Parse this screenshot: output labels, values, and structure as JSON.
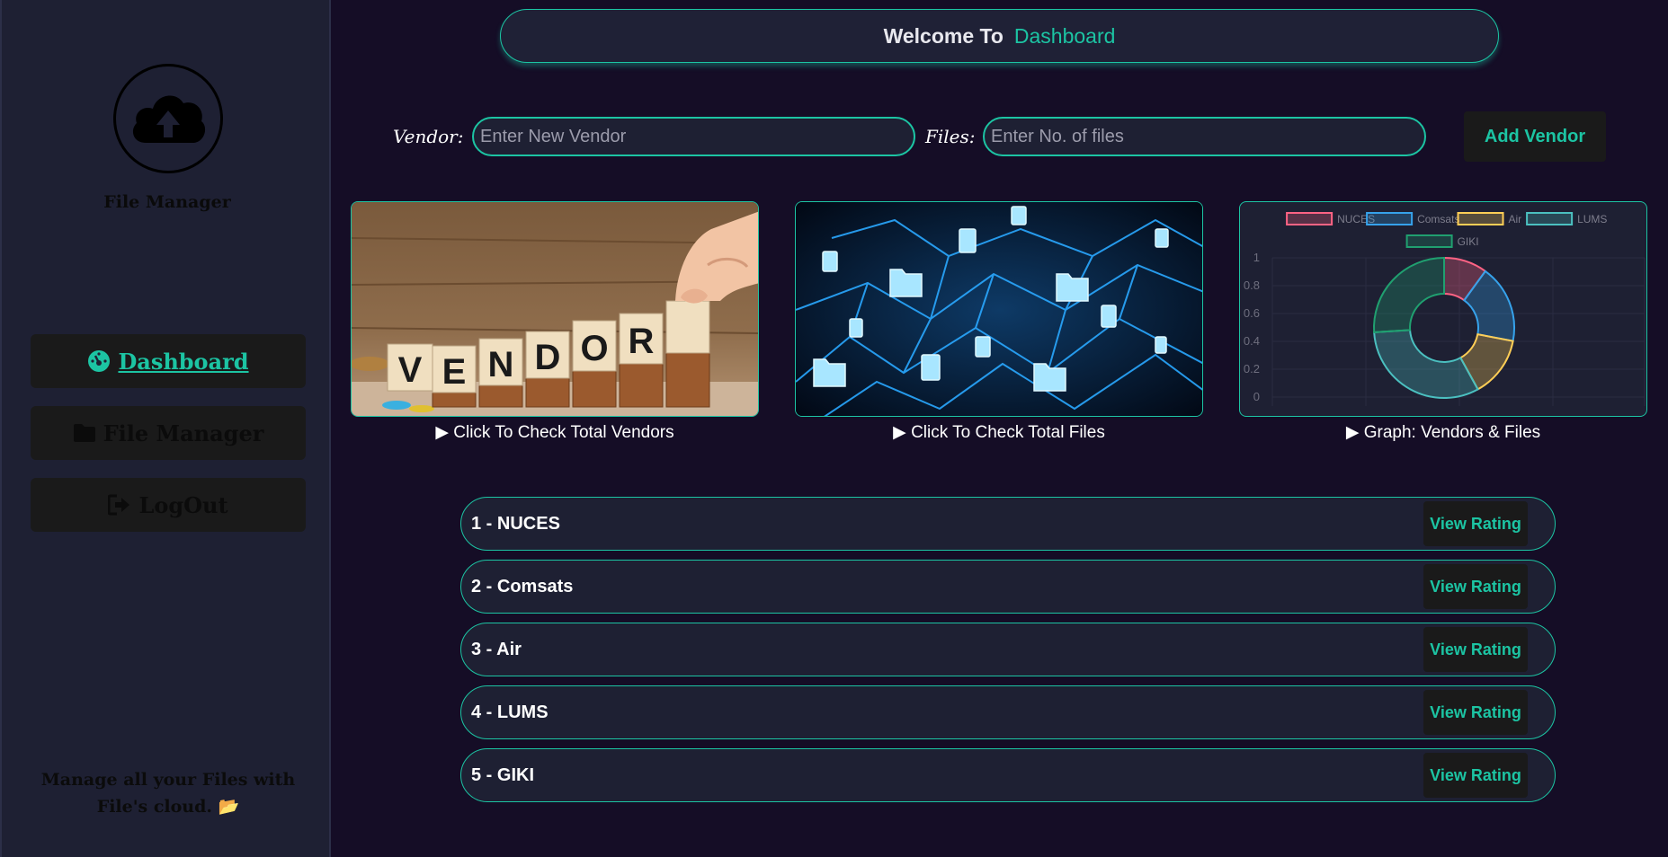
{
  "sidebar": {
    "brand": "File Manager",
    "nav": [
      {
        "label": "Dashboard",
        "icon": "tachometer-icon",
        "active": true
      },
      {
        "label": "File Manager",
        "icon": "folder-icon",
        "active": false
      },
      {
        "label": "LogOut",
        "icon": "logout-icon",
        "active": false
      }
    ],
    "footer": "Manage all your Files with File's cloud. 📂"
  },
  "header": {
    "welcome": "Welcome To",
    "accent": "Dashboard"
  },
  "form": {
    "vendor_label": "Vendor:",
    "vendor_placeholder": "Enter New Vendor",
    "files_label": "Files:",
    "files_placeholder": "Enter No. of files",
    "add_button": "Add Vendor"
  },
  "cards": {
    "vendors_caption": "▶ Click To Check Total Vendors",
    "files_caption": "▶ Click To Check Total Files",
    "graph_caption": "▶ Graph: Vendors & Files",
    "vendor_image_text": "VENDOR"
  },
  "chart_data": {
    "type": "doughnut",
    "legend": [
      {
        "name": "NUCES",
        "color": "#ff6384"
      },
      {
        "name": "Comsats",
        "color": "#36a2eb"
      },
      {
        "name": "Air",
        "color": "#ffce56"
      },
      {
        "name": "LUMS",
        "color": "#4bc0c0"
      },
      {
        "name": "GIKI",
        "color": "#20a070"
      }
    ],
    "values": [
      10,
      18,
      14,
      32,
      26
    ],
    "y_ticks": [
      "1",
      "0.8",
      "0.6",
      "0.4",
      "0.2",
      "0"
    ]
  },
  "vendors": [
    {
      "name": "1 - NUCES",
      "button": "View Rating"
    },
    {
      "name": "2 - Comsats",
      "button": "View Rating"
    },
    {
      "name": "3 - Air",
      "button": "View Rating"
    },
    {
      "name": "4 - LUMS",
      "button": "View Rating"
    },
    {
      "name": "5 - GIKI",
      "button": "View Rating"
    }
  ],
  "colors": {
    "accent": "#1cc4a3",
    "background": "#150d26",
    "panel": "#1e2033"
  }
}
